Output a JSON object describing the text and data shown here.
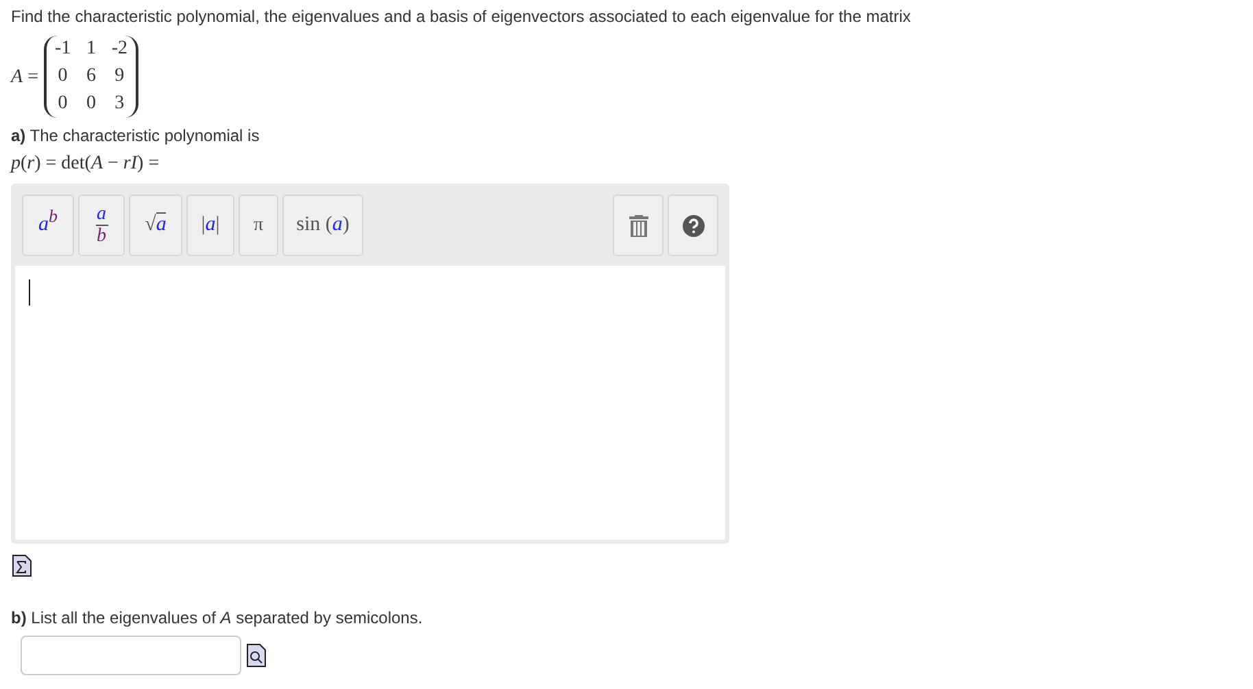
{
  "question": "Find the characteristic polynomial, the eigenvalues and a basis of eigenvectors associated to each eigenvalue for the matrix",
  "matrix": {
    "name": "A",
    "equals": "=",
    "rows": [
      [
        "-1",
        "1",
        "-2"
      ],
      [
        "0",
        "6",
        "9"
      ],
      [
        "0",
        "0",
        "3"
      ]
    ]
  },
  "part_a": {
    "label": "a)",
    "text": "The characteristic polynomial is",
    "formula": "*p*(*r*) = det(*A* − *rI*) ="
  },
  "toolbar": [
    {
      "kind": "power",
      "base": "a",
      "exponent": "b"
    },
    {
      "kind": "fraction",
      "numerator": "a",
      "denominator": "b"
    },
    {
      "kind": "sqrt",
      "symbol": "√",
      "argument": "a"
    },
    {
      "kind": "abs",
      "bar": "|",
      "argument": "a"
    },
    {
      "kind": "constant",
      "symbol": "π"
    },
    {
      "kind": "function",
      "name": "sin",
      "open": "(",
      "argument": "a",
      "close": ")"
    }
  ],
  "part_b": {
    "label": "b)",
    "text": "List all the eigenvalues of *A* separated by semicolons."
  }
}
